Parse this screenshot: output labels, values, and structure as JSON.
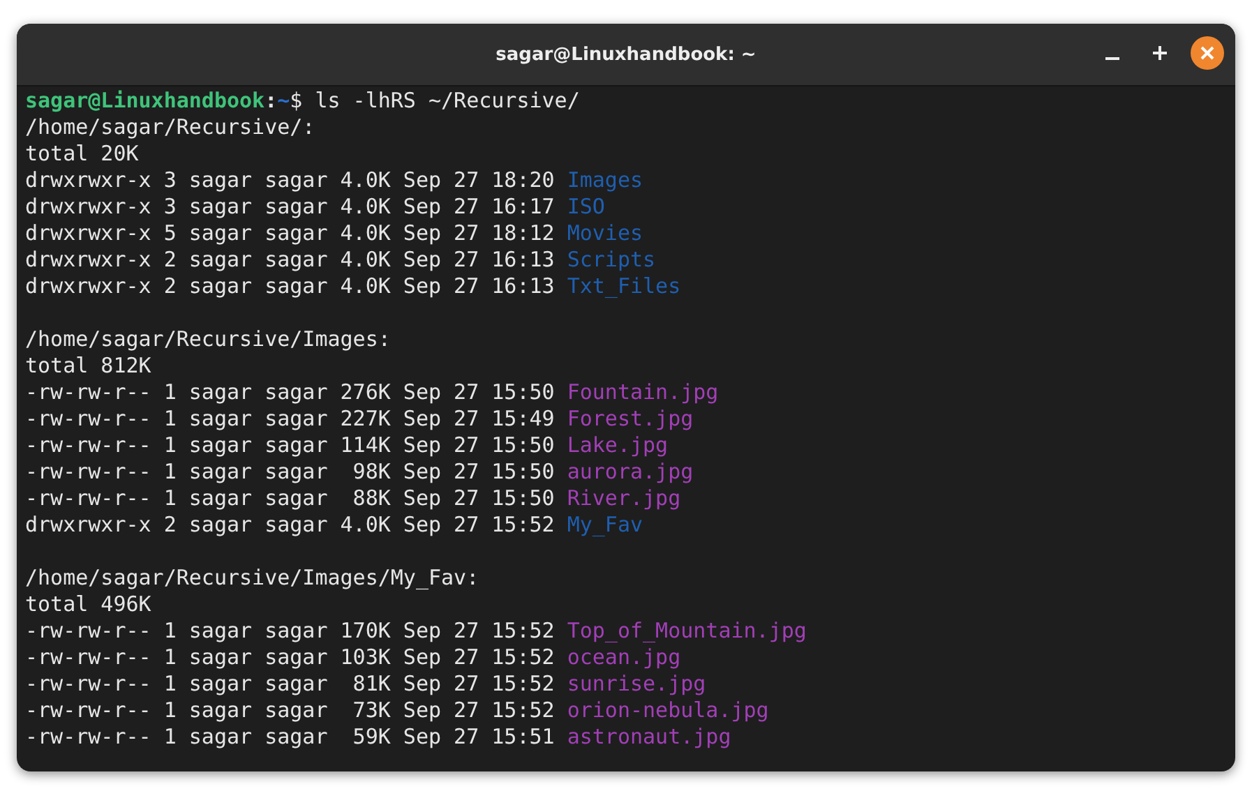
{
  "window": {
    "title": "sagar@Linuxhandbook: ~"
  },
  "lines": [
    {
      "kind": "prompt",
      "user": "sagar@Linuxhandbook",
      "separator": ":",
      "path": "~",
      "command": "$ ls -lhRS ~/Recursive/"
    },
    {
      "kind": "text",
      "text": "/home/sagar/Recursive/:"
    },
    {
      "kind": "text",
      "text": "total 20K"
    },
    {
      "kind": "directory",
      "info": "drwxrwxr-x 3 sagar sagar 4.0K Sep 27 18:20 ",
      "name": "Images"
    },
    {
      "kind": "directory",
      "info": "drwxrwxr-x 3 sagar sagar 4.0K Sep 27 16:17 ",
      "name": "ISO"
    },
    {
      "kind": "directory",
      "info": "drwxrwxr-x 5 sagar sagar 4.0K Sep 27 18:12 ",
      "name": "Movies"
    },
    {
      "kind": "directory",
      "info": "drwxrwxr-x 2 sagar sagar 4.0K Sep 27 16:13 ",
      "name": "Scripts"
    },
    {
      "kind": "directory",
      "info": "drwxrwxr-x 2 sagar sagar 4.0K Sep 27 16:13 ",
      "name": "Txt_Files"
    },
    {
      "kind": "blank"
    },
    {
      "kind": "text",
      "text": "/home/sagar/Recursive/Images:"
    },
    {
      "kind": "text",
      "text": "total 812K"
    },
    {
      "kind": "file",
      "info": "-rw-rw-r-- 1 sagar sagar 276K Sep 27 15:50 ",
      "name": "Fountain.jpg"
    },
    {
      "kind": "file",
      "info": "-rw-rw-r-- 1 sagar sagar 227K Sep 27 15:49 ",
      "name": "Forest.jpg"
    },
    {
      "kind": "file",
      "info": "-rw-rw-r-- 1 sagar sagar 114K Sep 27 15:50 ",
      "name": "Lake.jpg"
    },
    {
      "kind": "file",
      "info": "-rw-rw-r-- 1 sagar sagar  98K Sep 27 15:50 ",
      "name": "aurora.jpg"
    },
    {
      "kind": "file",
      "info": "-rw-rw-r-- 1 sagar sagar  88K Sep 27 15:50 ",
      "name": "River.jpg"
    },
    {
      "kind": "directory",
      "info": "drwxrwxr-x 2 sagar sagar 4.0K Sep 27 15:52 ",
      "name": "My_Fav"
    },
    {
      "kind": "blank"
    },
    {
      "kind": "text",
      "text": "/home/sagar/Recursive/Images/My_Fav:"
    },
    {
      "kind": "text",
      "text": "total 496K"
    },
    {
      "kind": "file",
      "info": "-rw-rw-r-- 1 sagar sagar 170K Sep 27 15:52 ",
      "name": "Top_of_Mountain.jpg"
    },
    {
      "kind": "file",
      "info": "-rw-rw-r-- 1 sagar sagar 103K Sep 27 15:52 ",
      "name": "ocean.jpg"
    },
    {
      "kind": "file",
      "info": "-rw-rw-r-- 1 sagar sagar  81K Sep 27 15:52 ",
      "name": "sunrise.jpg"
    },
    {
      "kind": "file",
      "info": "-rw-rw-r-- 1 sagar sagar  73K Sep 27 15:52 ",
      "name": "orion-nebula.jpg"
    },
    {
      "kind": "file",
      "info": "-rw-rw-r-- 1 sagar sagar  59K Sep 27 15:51 ",
      "name": "astronaut.jpg"
    }
  ]
}
